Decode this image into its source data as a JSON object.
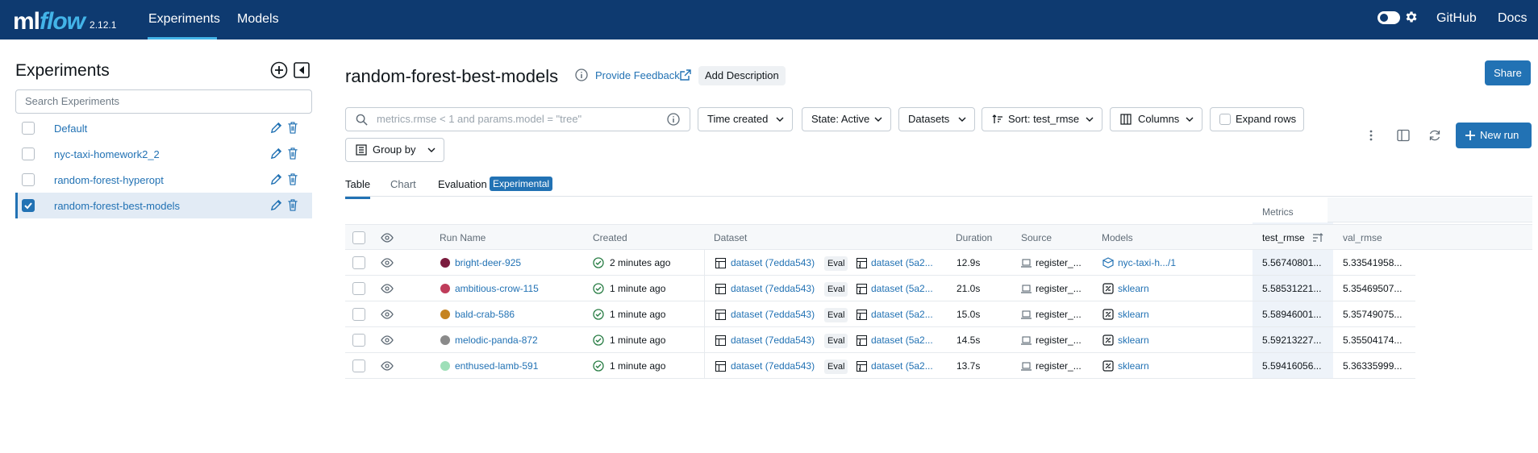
{
  "app": {
    "logo_ml": "ml",
    "logo_flow": "flow",
    "version": "2.12.1",
    "nav": {
      "experiments": "Experiments",
      "models": "Models"
    },
    "links": {
      "github": "GitHub",
      "docs": "Docs"
    },
    "colors": {
      "header_bg": "#0e3a70",
      "accent": "#2272b4",
      "logo_flow": "#43b4e8"
    }
  },
  "sidebar": {
    "title": "Experiments",
    "search_placeholder": "Search Experiments",
    "experiments": [
      {
        "name": "Default",
        "selected": false
      },
      {
        "name": "nyc-taxi-homework2_2",
        "selected": false
      },
      {
        "name": "random-forest-hyperopt",
        "selected": false
      },
      {
        "name": "random-forest-best-models",
        "selected": true
      }
    ]
  },
  "main": {
    "title": "random-forest-best-models",
    "feedback": "Provide Feedback",
    "add_description": "Add Description",
    "share": "Share",
    "search_placeholder": "metrics.rmse < 1 and params.model = \"tree\"",
    "toolbar": {
      "time_created": "Time created",
      "state": "State: Active",
      "datasets": "Datasets",
      "sort": "Sort: test_rmse",
      "columns": "Columns",
      "expand_rows": "Expand rows",
      "group_by": "Group by",
      "new_run": "New run"
    },
    "tabs": {
      "table": "Table",
      "chart": "Chart",
      "evaluation": "Evaluation",
      "experimental": "Experimental"
    }
  },
  "table": {
    "metrics_group": "Metrics",
    "headers": {
      "run_name": "Run Name",
      "created": "Created",
      "dataset": "Dataset",
      "duration": "Duration",
      "source": "Source",
      "models": "Models",
      "test_rmse": "test_rmse",
      "val_rmse": "val_rmse"
    },
    "eval_tag": "Eval",
    "comma": ",",
    "rows": [
      {
        "color": "#7b1c3e",
        "name": "bright-deer-925",
        "created": "2 minutes ago",
        "ds1": "dataset (7edda543)",
        "ds2": "dataset (5a2...",
        "duration": "12.9s",
        "source": "register_...",
        "model_icon": "registered-model-icon",
        "model": "nyc-taxi-h.../1",
        "test_rmse": "5.56740801...",
        "val_rmse": "5.33541958..."
      },
      {
        "color": "#bf3c5a",
        "name": "ambitious-crow-115",
        "created": "1 minute ago",
        "ds1": "dataset (7edda543)",
        "ds2": "dataset (5a2...",
        "duration": "21.0s",
        "source": "register_...",
        "model_icon": "sklearn-icon",
        "model": "sklearn",
        "test_rmse": "5.58531221...",
        "val_rmse": "5.35469507..."
      },
      {
        "color": "#c58320",
        "name": "bald-crab-586",
        "created": "1 minute ago",
        "ds1": "dataset (7edda543)",
        "ds2": "dataset (5a2...",
        "duration": "15.0s",
        "source": "register_...",
        "model_icon": "sklearn-icon",
        "model": "sklearn",
        "test_rmse": "5.58946001...",
        "val_rmse": "5.35749075..."
      },
      {
        "color": "#8a8a8a",
        "name": "melodic-panda-872",
        "created": "1 minute ago",
        "ds1": "dataset (7edda543)",
        "ds2": "dataset (5a2...",
        "duration": "14.5s",
        "source": "register_...",
        "model_icon": "sklearn-icon",
        "model": "sklearn",
        "test_rmse": "5.59213227...",
        "val_rmse": "5.35504174..."
      },
      {
        "color": "#9edfb8",
        "name": "enthused-lamb-591",
        "created": "1 minute ago",
        "ds1": "dataset (7edda543)",
        "ds2": "dataset (5a2...",
        "duration": "13.7s",
        "source": "register_...",
        "model_icon": "sklearn-icon",
        "model": "sklearn",
        "test_rmse": "5.59416056...",
        "val_rmse": "5.36335999..."
      }
    ]
  }
}
